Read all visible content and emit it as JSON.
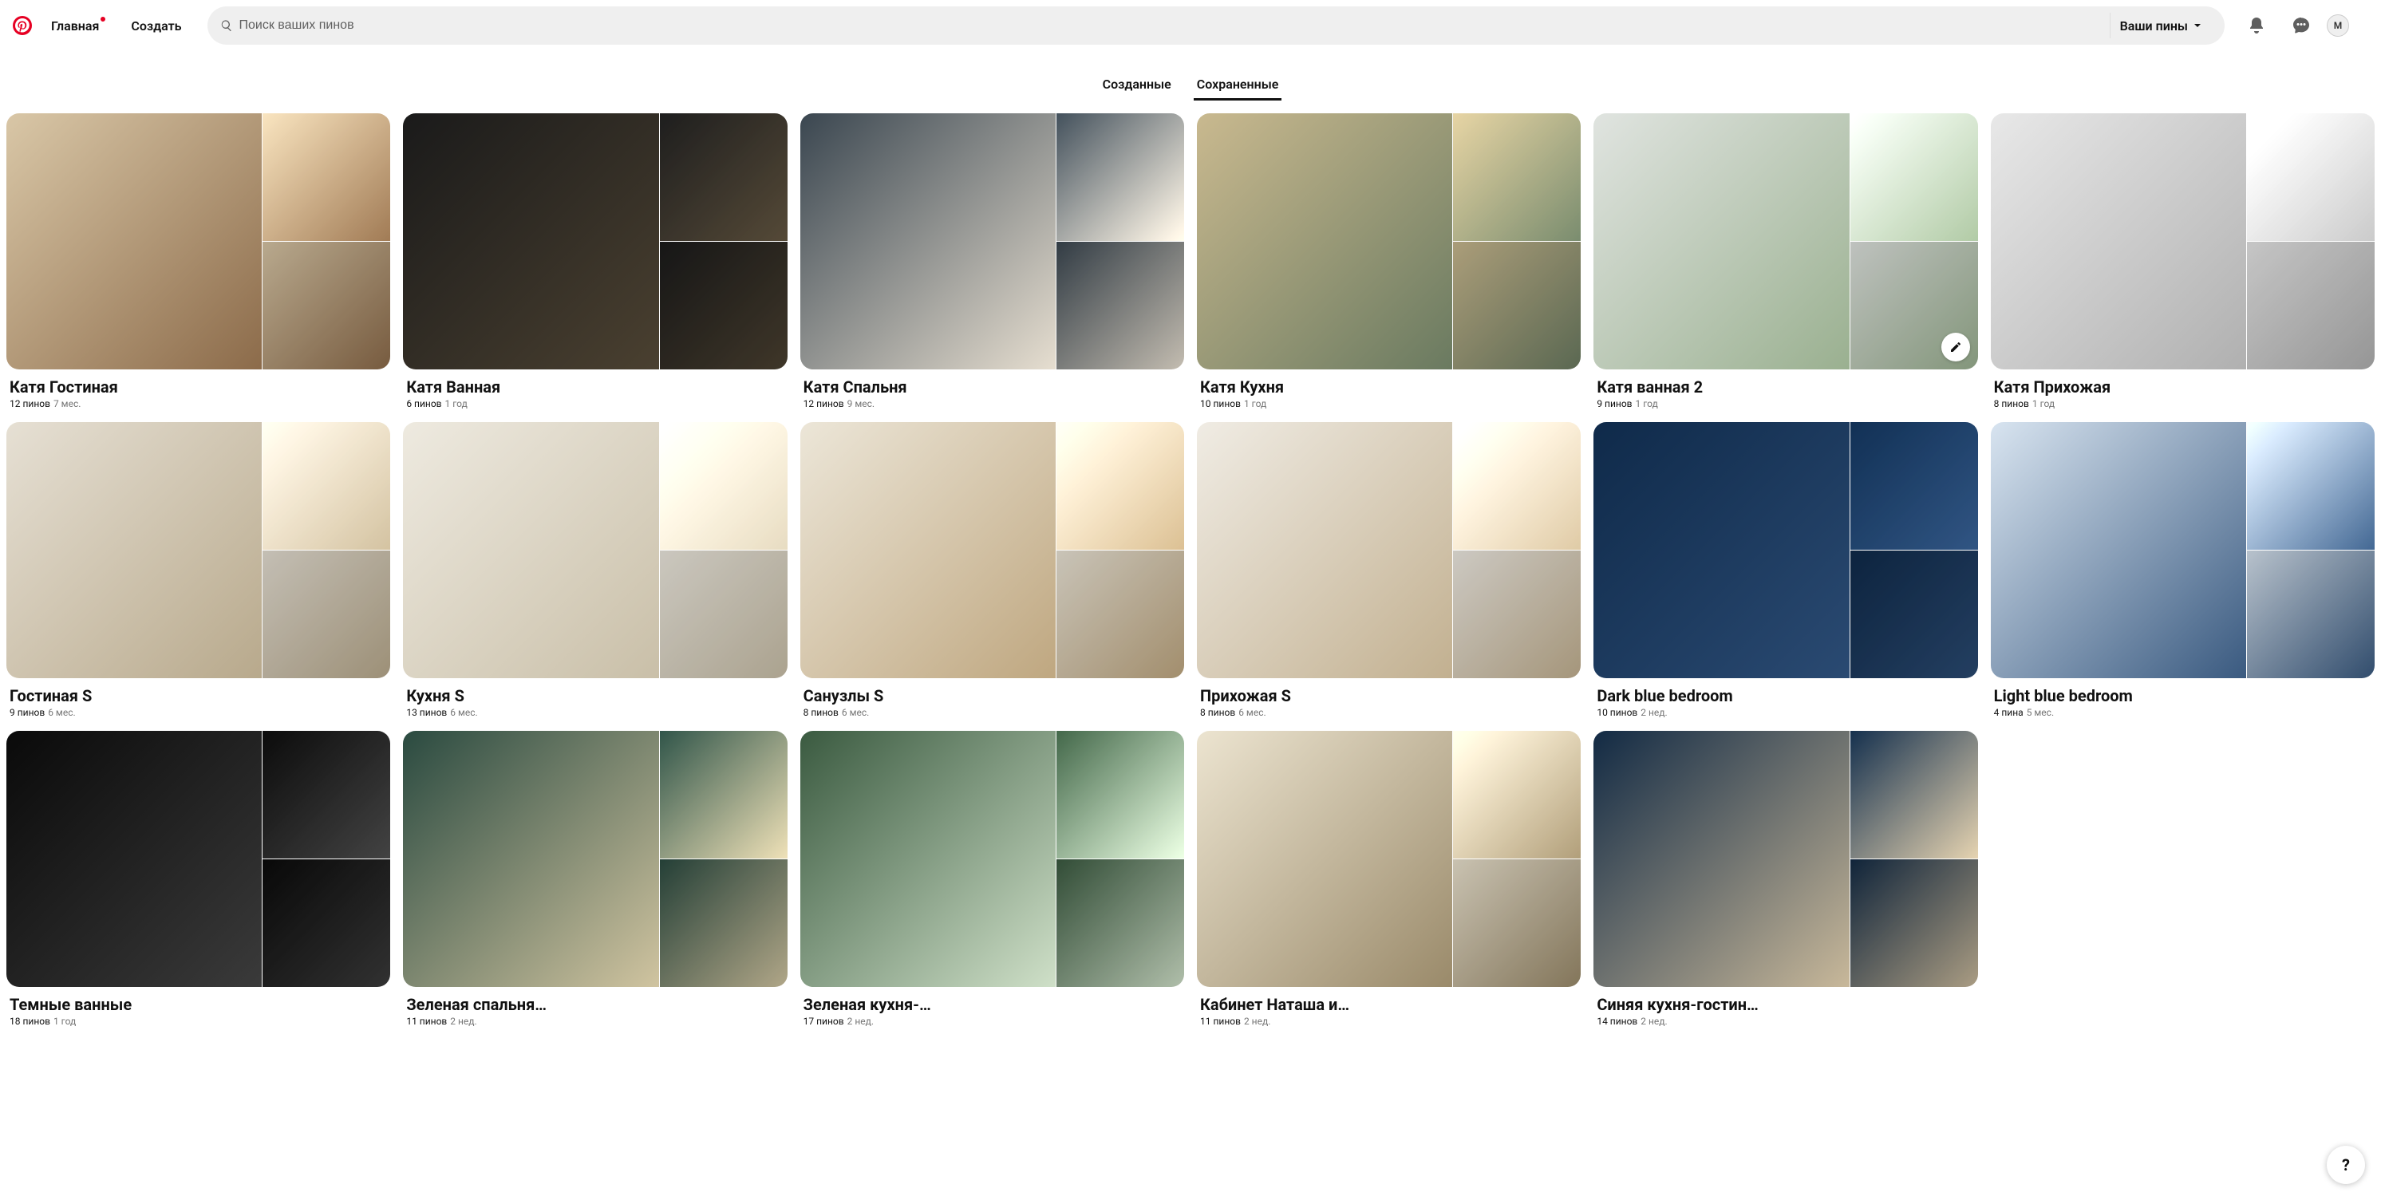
{
  "header": {
    "home": "Главная",
    "create": "Создать",
    "search_placeholder": "Поиск ваших пинов",
    "filter": "Ваши пины",
    "avatar_initial": "M"
  },
  "tabs": {
    "created": "Созданные",
    "saved": "Сохраненные",
    "active": "saved"
  },
  "boards": [
    {
      "title": "Катя Гостиная",
      "pins": "12 пинов",
      "age": "7 мес.",
      "palette": 0
    },
    {
      "title": "Катя Ванная",
      "pins": "6 пинов",
      "age": "1 год",
      "palette": 1
    },
    {
      "title": "Катя Спальня",
      "pins": "12 пинов",
      "age": "9 мес.",
      "palette": 2
    },
    {
      "title": "Катя Кухня",
      "pins": "10 пинов",
      "age": "1 год",
      "palette": 3
    },
    {
      "title": "Катя ванная 2",
      "pins": "9 пинов",
      "age": "1 год",
      "palette": 4,
      "show_edit": true
    },
    {
      "title": "Катя Прихожая",
      "pins": "8 пинов",
      "age": "1 год",
      "palette": 5
    },
    {
      "title": "Гостиная S",
      "pins": "9 пинов",
      "age": "6 мес.",
      "palette": 6
    },
    {
      "title": "Кухня S",
      "pins": "13 пинов",
      "age": "6 мес.",
      "palette": 7
    },
    {
      "title": "Санузлы S",
      "pins": "8 пинов",
      "age": "6 мес.",
      "palette": 8
    },
    {
      "title": "Прихожая S",
      "pins": "8 пинов",
      "age": "6 мес.",
      "palette": 9
    },
    {
      "title": "Dark blue bedroom",
      "pins": "10 пинов",
      "age": "2 нед.",
      "palette": 10
    },
    {
      "title": "Light blue bedroom",
      "pins": "4 пина",
      "age": "5 мес.",
      "palette": 11
    },
    {
      "title": "Темные ванные",
      "pins": "18 пинов",
      "age": "1 год",
      "palette": 12
    },
    {
      "title": "Зеленая спальня…",
      "pins": "11 пинов",
      "age": "2 нед.",
      "palette": 13
    },
    {
      "title": "Зеленая кухня-…",
      "pins": "17 пинов",
      "age": "2 нед.",
      "palette": 14
    },
    {
      "title": "Кабинет Наташа и…",
      "pins": "11 пинов",
      "age": "2 нед.",
      "palette": 15
    },
    {
      "title": "Синяя кухня-гостин…",
      "pins": "14 пинов",
      "age": "2 нед.",
      "palette": 16
    }
  ],
  "help": "?"
}
